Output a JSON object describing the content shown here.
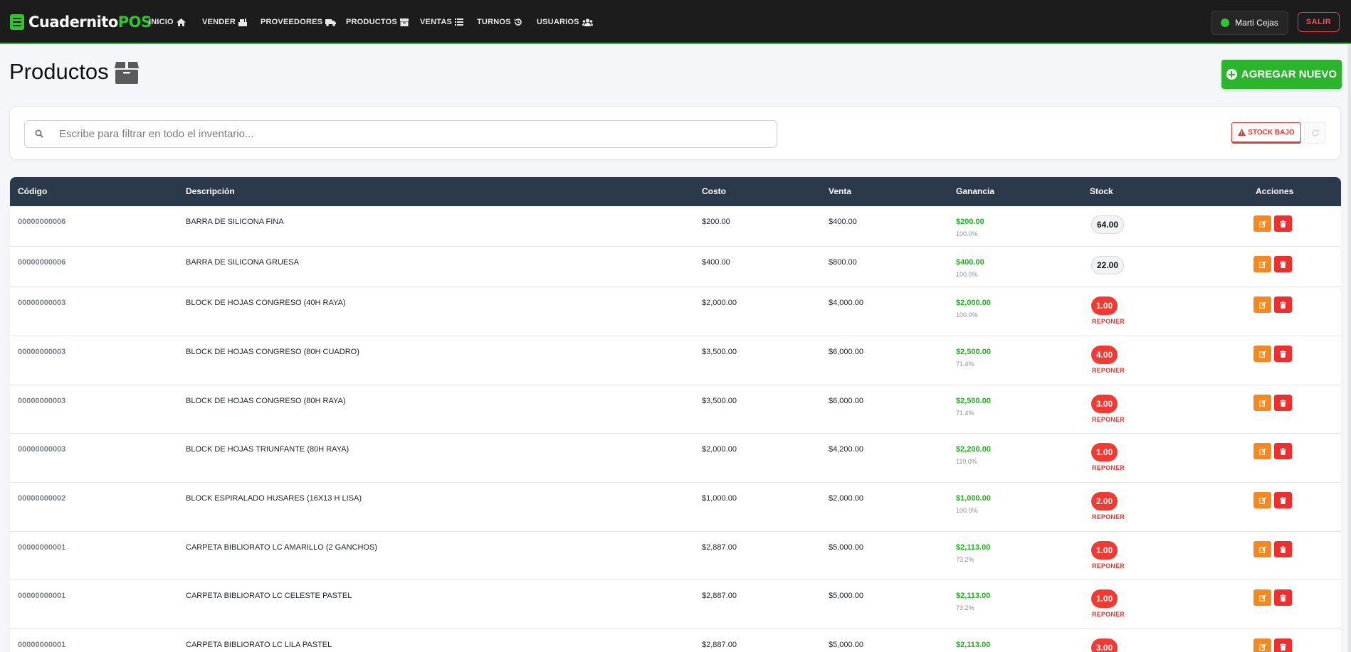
{
  "brand": {
    "name_main": "Cuadernito",
    "name_accent": "POS",
    "icon": "notebook-icon",
    "accent_color": "#2fc72f"
  },
  "nav": {
    "items": [
      {
        "label": "INICIO",
        "icon": "home-icon"
      },
      {
        "label": "VENDER",
        "icon": "cash-register-icon"
      },
      {
        "label": "PROVEEDORES",
        "icon": "truck-icon"
      },
      {
        "label": "PRODUCTOS",
        "icon": "box-icon"
      },
      {
        "label": "VENTAS",
        "icon": "list-icon"
      },
      {
        "label": "TURNOS",
        "icon": "history-icon"
      },
      {
        "label": "USUARIOS",
        "icon": "users-icon"
      }
    ],
    "user": "Marti Cejas",
    "logout_label": "SALIR"
  },
  "page": {
    "title": "Productos",
    "title_icon": "box-icon",
    "add_label": "AGREGAR NUEVO"
  },
  "filter": {
    "placeholder": "Escribe para filtrar en todo el inventario...",
    "value": "",
    "stock_low_label": "STOCK BAJO"
  },
  "table": {
    "headers": {
      "code": "Código",
      "description": "Descripción",
      "cost": "Costo",
      "sale": "Venta",
      "profit": "Ganancia",
      "stock": "Stock",
      "actions": "Acciones"
    },
    "restock_label": "REPONER",
    "rows": [
      {
        "code": "00000000006",
        "description": "BARRA DE SILICONA FINA",
        "cost": "$200.00",
        "sale": "$400.00",
        "profit": "$200.00",
        "pct": "100.0%",
        "stock": "64.00",
        "low": false
      },
      {
        "code": "00000000006",
        "description": "BARRA DE SILICONA GRUESA",
        "cost": "$400.00",
        "sale": "$800.00",
        "profit": "$400.00",
        "pct": "100.0%",
        "stock": "22.00",
        "low": false
      },
      {
        "code": "00000000003",
        "description": "BLOCK DE HOJAS CONGRESO (40H RAYA)",
        "cost": "$2,000.00",
        "sale": "$4,000.00",
        "profit": "$2,000.00",
        "pct": "100.0%",
        "stock": "1.00",
        "low": true
      },
      {
        "code": "00000000003",
        "description": "BLOCK DE HOJAS CONGRESO (80H CUADRO)",
        "cost": "$3,500.00",
        "sale": "$6,000.00",
        "profit": "$2,500.00",
        "pct": "71.4%",
        "stock": "4.00",
        "low": true
      },
      {
        "code": "00000000003",
        "description": "BLOCK DE HOJAS CONGRESO (80H RAYA)",
        "cost": "$3,500.00",
        "sale": "$6,000.00",
        "profit": "$2,500.00",
        "pct": "71.4%",
        "stock": "3.00",
        "low": true
      },
      {
        "code": "00000000003",
        "description": "BLOCK DE HOJAS TRIUNFANTE (80H RAYA)",
        "cost": "$2,000.00",
        "sale": "$4,200.00",
        "profit": "$2,200.00",
        "pct": "110.0%",
        "stock": "1.00",
        "low": true
      },
      {
        "code": "00000000002",
        "description": "BLOCK ESPIRALADO HUSARES (16X13 H LISA)",
        "cost": "$1,000.00",
        "sale": "$2,000.00",
        "profit": "$1,000.00",
        "pct": "100.0%",
        "stock": "2.00",
        "low": true
      },
      {
        "code": "00000000001",
        "description": "CARPETA BIBLIORATO LC AMARILLO (2 GANCHOS)",
        "cost": "$2,887.00",
        "sale": "$5,000.00",
        "profit": "$2,113.00",
        "pct": "73.2%",
        "stock": "1.00",
        "low": true
      },
      {
        "code": "00000000001",
        "description": "CARPETA BIBLIORATO LC CELESTE PASTEL",
        "cost": "$2,887.00",
        "sale": "$5,000.00",
        "profit": "$2,113.00",
        "pct": "73.2%",
        "stock": "1.00",
        "low": true
      },
      {
        "code": "00000000001",
        "description": "CARPETA BIBLIORATO LC LILA PASTEL",
        "cost": "$2,887.00",
        "sale": "$5,000.00",
        "profit": "$2,113.00",
        "pct": "",
        "stock": "3.00",
        "low": true
      }
    ]
  },
  "colors": {
    "navbar": "#1c1c1c",
    "success": "#2db42d",
    "danger": "#f23a33",
    "warning": "#f5891f",
    "table_header": "#2b3a4b"
  }
}
